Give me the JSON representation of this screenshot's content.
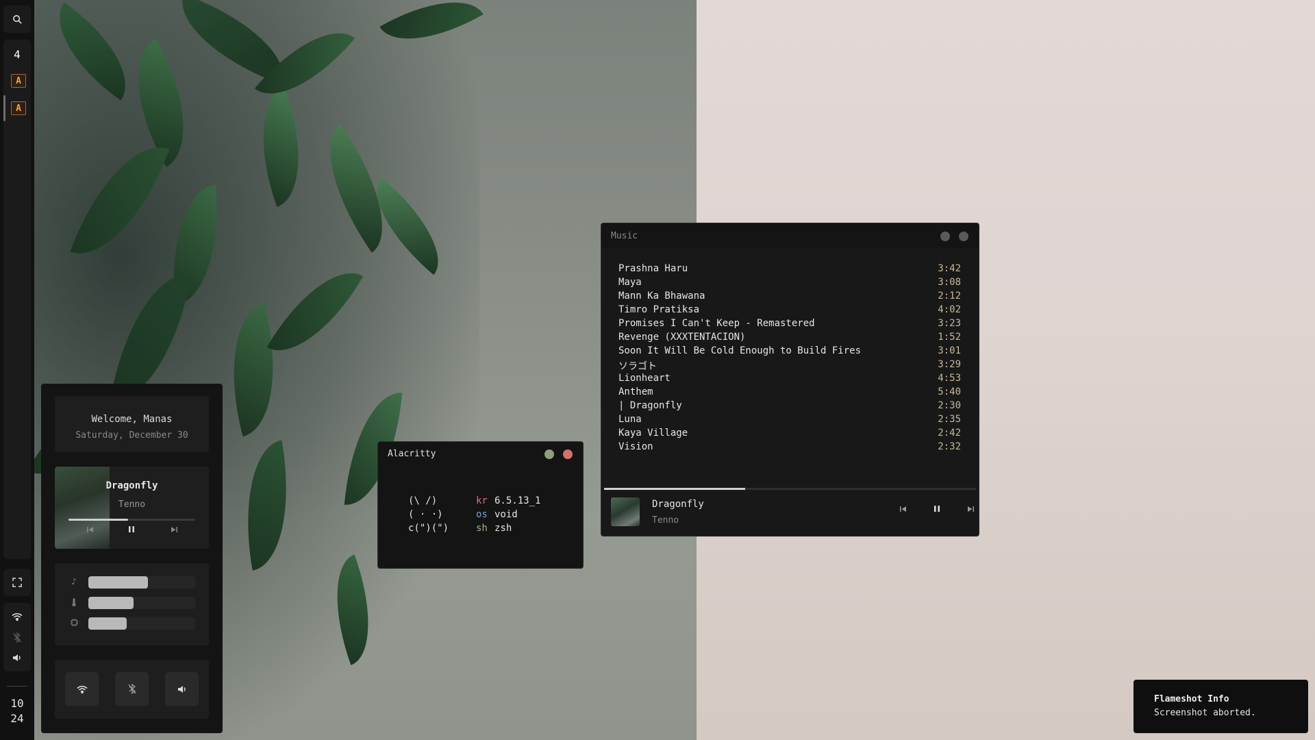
{
  "bar": {
    "workspace": "4",
    "clock_hour": "10",
    "clock_minute": "24",
    "icons": [
      "search-icon",
      "alacritty-icon",
      "fullscreen-icon",
      "wifi-icon",
      "bluetooth-off-icon",
      "volume-icon"
    ]
  },
  "dashboard": {
    "welcome": "Welcome, Manas",
    "date": "Saturday, December 30",
    "player": {
      "title": "Dragonfly",
      "artist": "Tenno",
      "progress": 0.47
    },
    "sliders": [
      {
        "icon": "music-note-icon",
        "level": 0.56
      },
      {
        "icon": "thermometer-icon",
        "level": 0.42
      },
      {
        "icon": "cpu-icon",
        "level": 0.36
      }
    ],
    "toggles": [
      "wifi-icon",
      "bluetooth-off-icon",
      "volume-icon"
    ]
  },
  "alacritty": {
    "title": "Alacritty",
    "ascii": [
      "(\\ /)",
      "( · ·)",
      "c(\")(\")"
    ],
    "info": [
      {
        "key": "kr",
        "value": "6.5.13_1",
        "color": "#e06c75"
      },
      {
        "key": "os",
        "value": "void",
        "color": "#7aa2c8"
      },
      {
        "key": "sh",
        "value": "zsh",
        "color": "#98b88a"
      }
    ],
    "dot_colors": [
      "#8f9f7d",
      "#d2716f"
    ]
  },
  "music": {
    "title": "Music",
    "tracks": [
      {
        "name": "Prashna Haru",
        "duration": "3:42"
      },
      {
        "name": "Maya",
        "duration": "3:08"
      },
      {
        "name": "Mann Ka Bhawana",
        "duration": "2:12"
      },
      {
        "name": "Timro Pratiksa",
        "duration": "4:02"
      },
      {
        "name": "Promises I Can't Keep - Remastered",
        "duration": "3:23"
      },
      {
        "name": "Revenge (XXXTENTACION)",
        "duration": "1:52"
      },
      {
        "name": "Soon It Will Be Cold Enough to Build Fires",
        "duration": "3:01"
      },
      {
        "name": "ソラゴト",
        "duration": "3:29"
      },
      {
        "name": "Lionheart",
        "duration": "4:53"
      },
      {
        "name": "Anthem",
        "duration": "5:40"
      },
      {
        "name": "| Dragonfly",
        "duration": "2:30"
      },
      {
        "name": "Luna",
        "duration": "2:35"
      },
      {
        "name": "Kaya Village",
        "duration": "2:42"
      },
      {
        "name": "Vision",
        "duration": "2:32"
      }
    ],
    "now_playing": {
      "title": "Dragonfly",
      "artist": "Tenno",
      "progress": 0.38
    }
  },
  "notification": {
    "title": "Flameshot Info",
    "body": "Screenshot aborted."
  }
}
